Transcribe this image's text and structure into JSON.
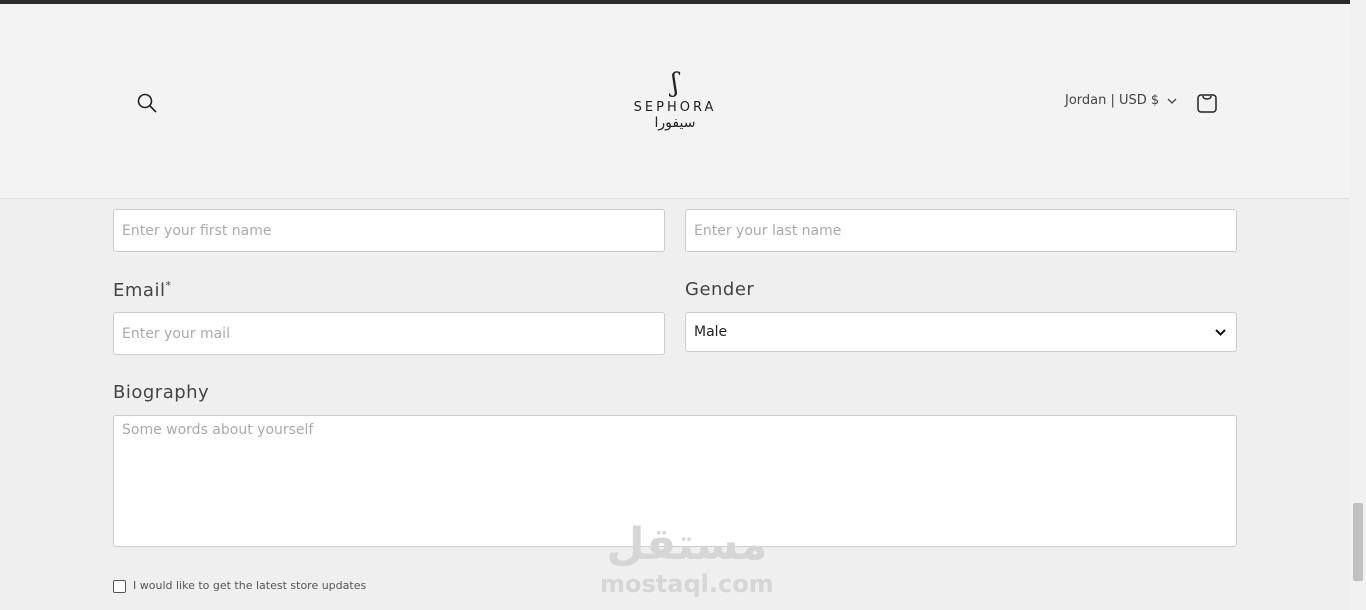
{
  "header": {
    "brand_en": "SEPHORA",
    "brand_ar": "سيفورا",
    "locale": "Jordan | USD $"
  },
  "form": {
    "first_name_placeholder": "Enter your first name",
    "last_name_placeholder": "Enter your last name",
    "email_label": "Email",
    "required_mark": "*",
    "email_placeholder": "Enter your mail",
    "gender_label": "Gender",
    "gender_value": "Male",
    "bio_label": "Biography",
    "bio_placeholder": "Some words about yourself",
    "updates_label": "I would like to get the latest store updates",
    "updates_checked": false
  },
  "watermark": {
    "ar": "مستقل",
    "en": "mostaql.com"
  }
}
